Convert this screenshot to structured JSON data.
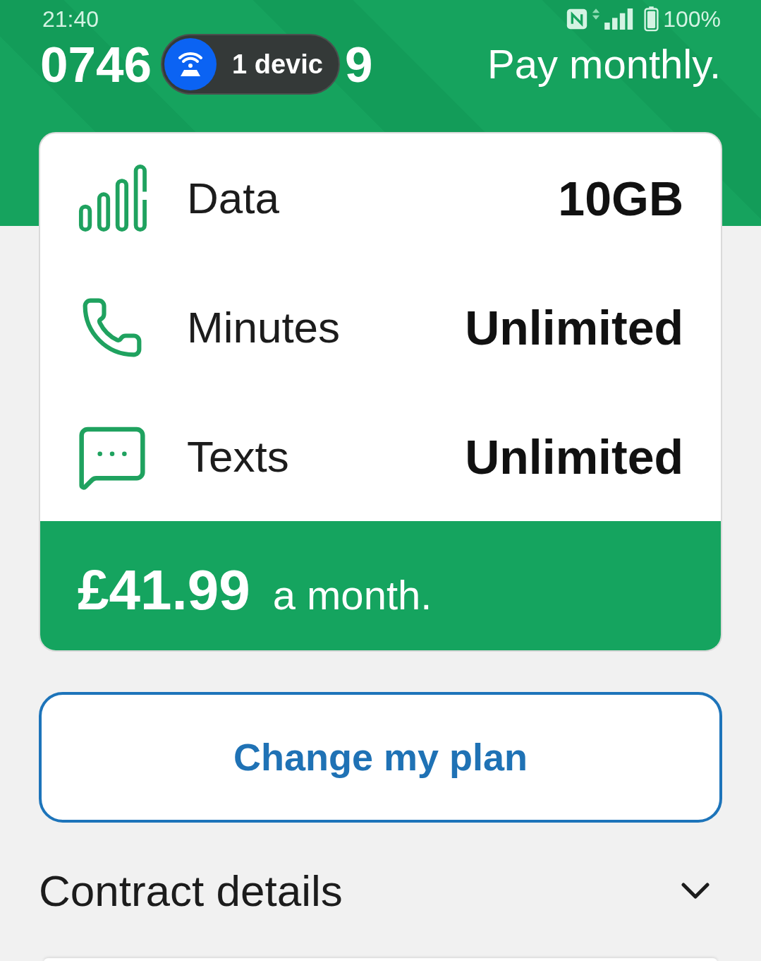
{
  "status_bar": {
    "time": "21:40",
    "battery": "100%"
  },
  "header": {
    "number_start": "0746",
    "number_end": "9",
    "title": "Pay monthly."
  },
  "hotspot_pill": {
    "label": "1 devic"
  },
  "plan": {
    "allowances": [
      {
        "kind": "data",
        "label": "Data",
        "value": "10GB"
      },
      {
        "kind": "minutes",
        "label": "Minutes",
        "value": "Unlimited"
      },
      {
        "kind": "texts",
        "label": "Texts",
        "value": "Unlimited"
      }
    ],
    "price": "£41.99",
    "period": "a month."
  },
  "change_plan_button": {
    "label": "Change my plan"
  },
  "contract_details": {
    "label": "Contract details",
    "expanded": false
  }
}
